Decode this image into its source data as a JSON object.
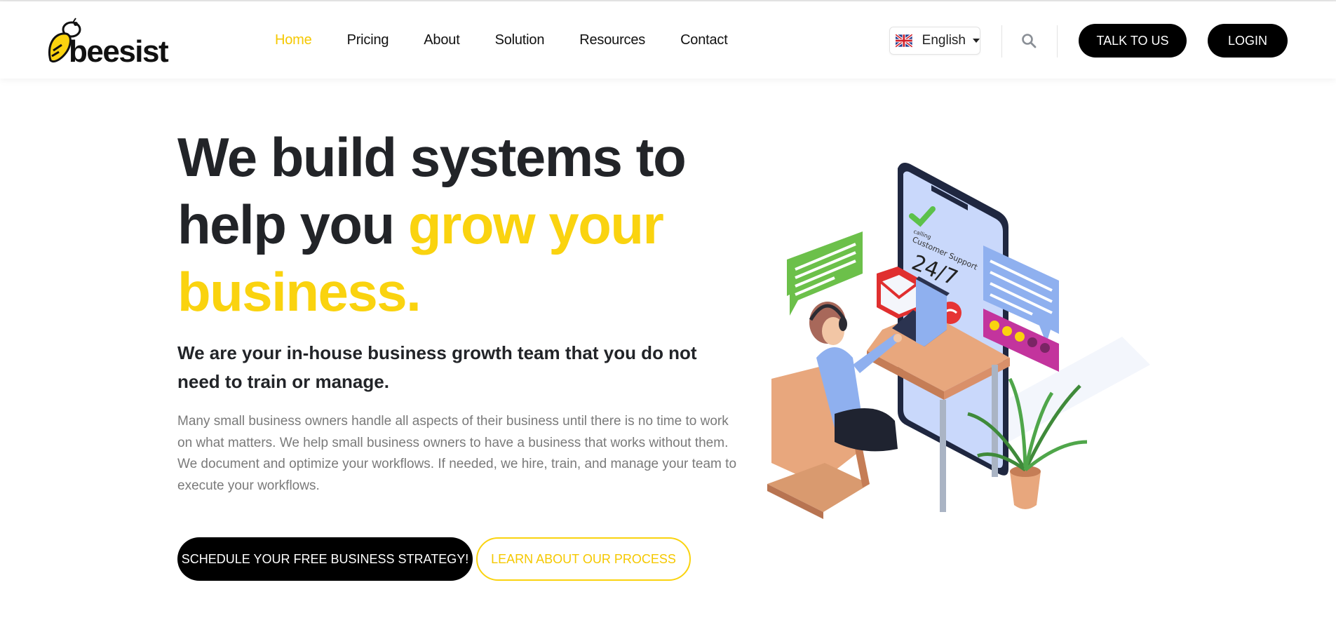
{
  "brand": {
    "name": "beesist",
    "accent": "#fad30f",
    "dark": "#222428"
  },
  "nav": {
    "items": [
      {
        "label": "Home",
        "active": true
      },
      {
        "label": "Pricing",
        "active": false
      },
      {
        "label": "About",
        "active": false
      },
      {
        "label": "Solution",
        "active": false
      },
      {
        "label": "Resources",
        "active": false
      },
      {
        "label": "Contact",
        "active": false
      }
    ]
  },
  "language": {
    "selected": "English",
    "flag_icon": "uk-flag-icon"
  },
  "header_actions": {
    "search_icon": "search-icon",
    "talk_label": "TALK TO US",
    "login_label": "LOGIN"
  },
  "hero": {
    "title_part1": "We build systems to help you ",
    "title_highlight": "grow your business.",
    "subtitle": "We are your in-house business growth team that you do not need to train or manage.",
    "description": "Many small business owners handle all aspects of their business until there is no time to work on what matters. We help small business owners to have a business that works without them. We document and optimize your workflows. If needed, we hire, train, and manage your team to execute your workflows.",
    "cta_primary": "SCHEDULE YOUR FREE BUSINESS STRATEGY!",
    "cta_secondary": "LEARN ABOUT OUR PROCESS"
  },
  "illustration": {
    "phone_caption": "Customer Support",
    "phone_small": "calling",
    "phone_hours": "24/7"
  }
}
